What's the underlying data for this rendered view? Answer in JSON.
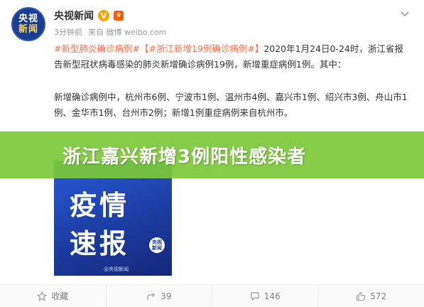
{
  "account": {
    "avatar_line1": "央视",
    "avatar_line2": "新闻",
    "name": "央视新闻",
    "verified_mark": "V",
    "meta_time": "3分钟前",
    "meta_source": "来自 微博 weibo.com"
  },
  "post": {
    "tag1": "#新型肺炎确诊病例#",
    "tag2": "【#浙江新增19例确诊病例#】",
    "line1_rest": "2020年1月24日0-24时，浙江省报告新型冠状病毒感染的肺炎新增确诊病例19例，新增重症病例1例。其中：",
    "para2": "新增确诊病例中，杭州市6例、宁波市1例、温州市4例、嘉兴市1例、绍兴市3例、舟山市1例、金华市1例、台州市2例；新增1例重症病例来自杭州市。"
  },
  "banner": {
    "title": "浙江嘉兴新增3例阳性感染者",
    "color": "#7cc838"
  },
  "image": {
    "line1": "疫情",
    "line2": "速报",
    "logo_top": "央视",
    "logo_bottom": "新闻",
    "watermark": "@央视新闻"
  },
  "actions": {
    "share": "收藏",
    "repost": "39",
    "comment": "146",
    "like": "572"
  },
  "icons": {
    "chevron": "chevron-down-icon",
    "share": "star-icon",
    "repost": "repost-icon",
    "comment": "comment-icon",
    "like": "thumbs-up-icon"
  }
}
